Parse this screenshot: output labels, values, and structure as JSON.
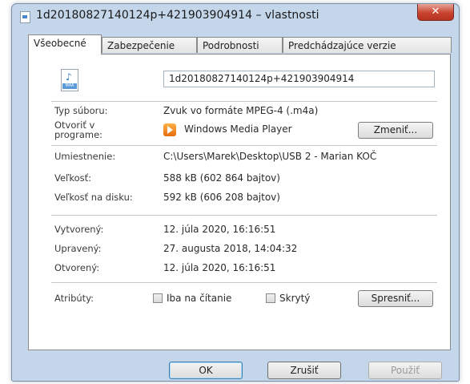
{
  "window": {
    "title": "1d20180827140124p+421903904914 – vlastnosti",
    "close_glyph": "✕"
  },
  "tabs": [
    {
      "label": "Všeobecné"
    },
    {
      "label": "Zabezpečenie"
    },
    {
      "label": "Podrobnosti"
    },
    {
      "label": "Predchádzajúce verzie"
    }
  ],
  "general": {
    "file_icon_ext": "M4A",
    "file_name": "1d20180827140124p+421903904914",
    "type_label": "Typ súboru:",
    "type_value": "Zvuk vo formáte MPEG-4 (.m4a)",
    "open_with_label": "Otvoriť v programe:",
    "open_with_value": "Windows Media Player",
    "change_button": "Zmeniť...",
    "location_label": "Umiestnenie:",
    "location_value": "C:\\Users\\Marek\\Desktop\\USB 2 - Marian KOČ",
    "size_label": "Veľkosť:",
    "size_value": "588 kB (602 864 bajtov)",
    "size_disk_label": "Veľkosť na disku:",
    "size_disk_value": "592 kB (606 208 bajtov)",
    "created_label": "Vytvorený:",
    "created_value": "12. júla 2020, 16:16:51",
    "modified_label": "Upravený:",
    "modified_value": "27. augusta 2018, 14:04:32",
    "accessed_label": "Otvorený:",
    "accessed_value": "12. júla 2020, 16:16:51",
    "attributes_label": "Atribúty:",
    "readonly_label": "Iba na čítanie",
    "hidden_label": "Skrytý",
    "advanced_button": "Spresniť..."
  },
  "footer": {
    "ok": "OK",
    "cancel": "Zrušiť",
    "apply": "Použiť"
  }
}
